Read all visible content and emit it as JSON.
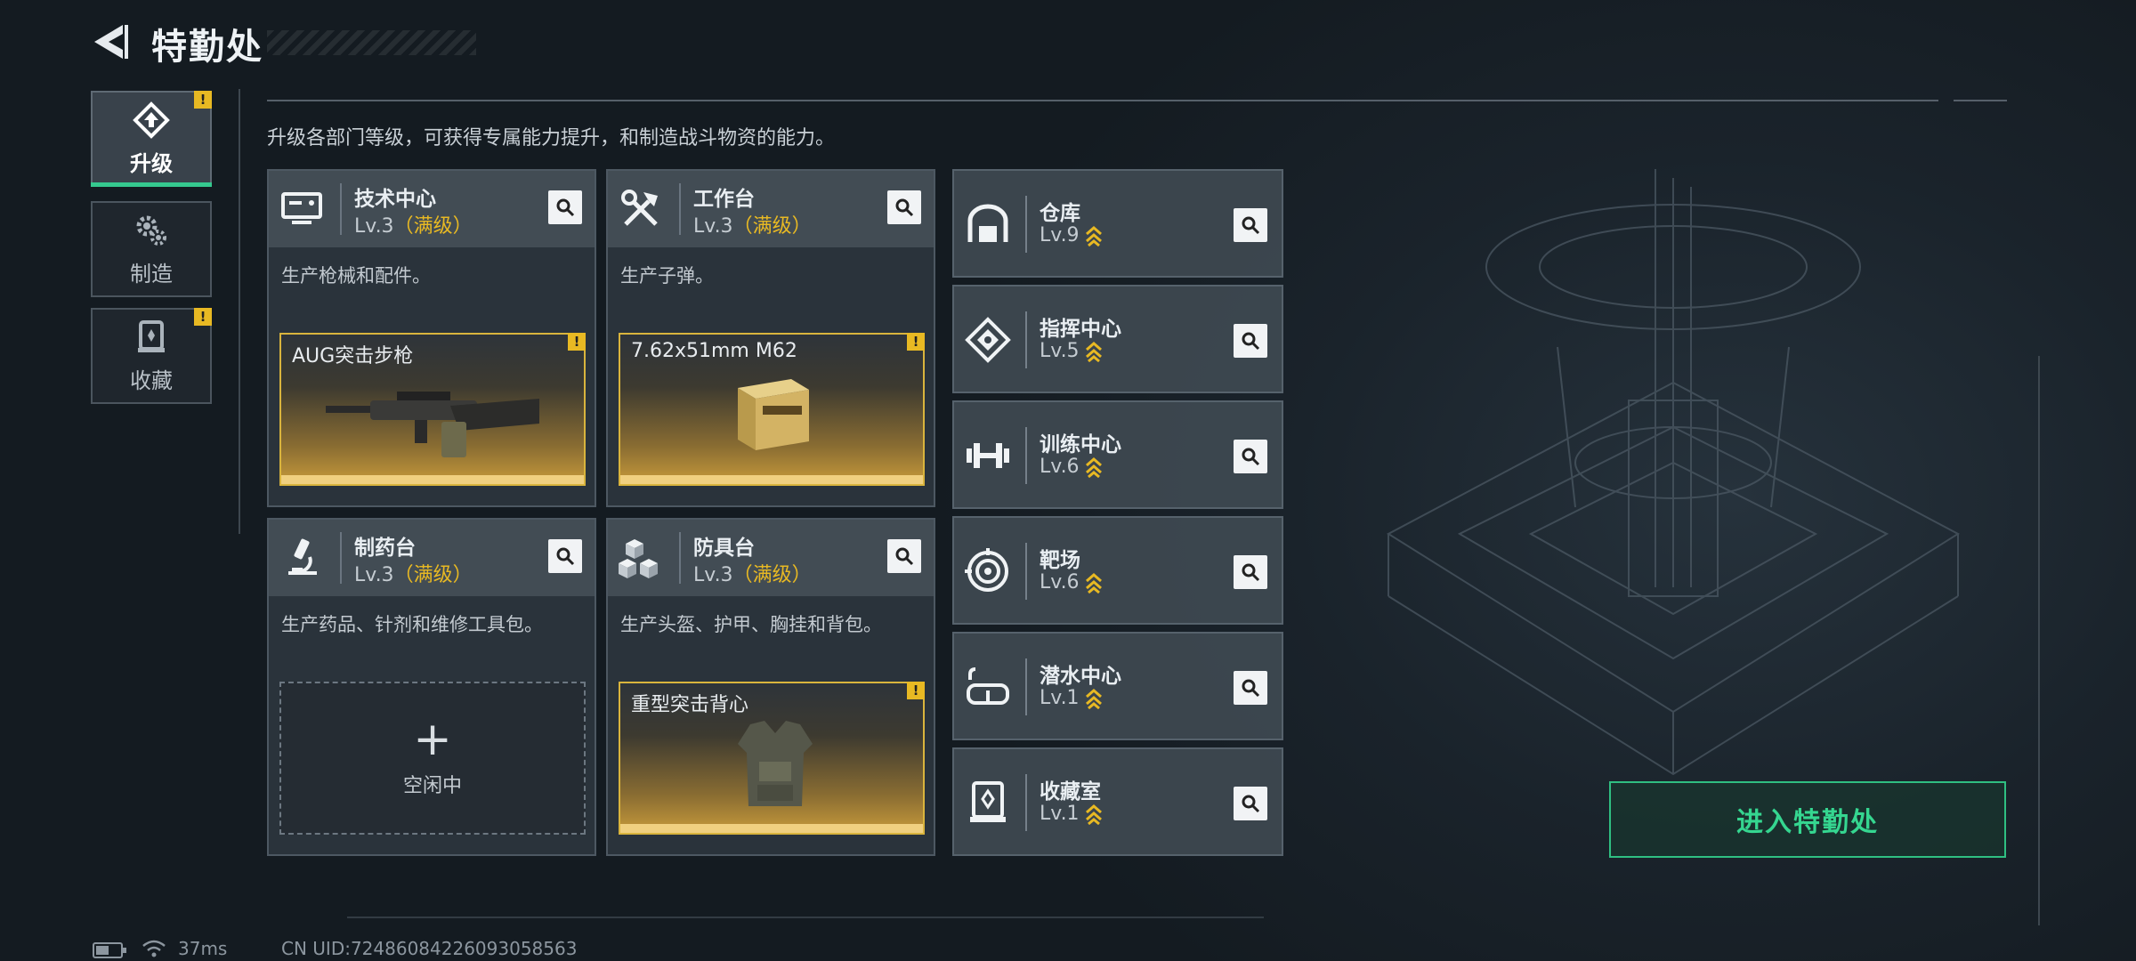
{
  "header": {
    "title": "特勤处"
  },
  "tabs": [
    {
      "label": "升级",
      "icon": "upgrade-icon",
      "active": true,
      "badge": "!"
    },
    {
      "label": "制造",
      "icon": "gears-icon",
      "active": false,
      "badge": ""
    },
    {
      "label": "收藏",
      "icon": "collection-icon",
      "active": false,
      "badge": "!"
    }
  ],
  "description": "升级各部门等级，可获得专属能力提升，和制造战斗物资的能力。",
  "cards": [
    {
      "name": "技术中心",
      "level": "Lv.3",
      "max": "（满级）",
      "icon": "computer-icon",
      "desc": "生产枪械和配件。",
      "slot": {
        "type": "item",
        "name": "AUG突击步枪",
        "badge": "!"
      }
    },
    {
      "name": "工作台",
      "level": "Lv.3",
      "max": "（满级）",
      "icon": "tools-icon",
      "desc": "生产子弹。",
      "slot": {
        "type": "item",
        "name": "7.62x51mm M62",
        "badge": "!"
      }
    },
    {
      "name": "制药台",
      "level": "Lv.3",
      "max": "（满级）",
      "icon": "microscope-icon",
      "desc": "生产药品、针剂和维修工具包。",
      "slot": {
        "type": "empty",
        "plus": "+",
        "name": "空闲中"
      }
    },
    {
      "name": "防具台",
      "level": "Lv.3",
      "max": "（满级）",
      "icon": "boxes-icon",
      "desc": "生产头盔、护甲、胸挂和背包。",
      "slot": {
        "type": "item",
        "name": "重型突击背心",
        "badge": "!"
      }
    }
  ],
  "facilities": [
    {
      "name": "仓库",
      "level": "Lv.9",
      "icon": "warehouse-icon"
    },
    {
      "name": "指挥中心",
      "level": "Lv.5",
      "icon": "command-icon"
    },
    {
      "name": "训练中心",
      "level": "Lv.6",
      "icon": "dumbbell-icon"
    },
    {
      "name": "靶场",
      "level": "Lv.6",
      "icon": "target-icon"
    },
    {
      "name": "潜水中心",
      "level": "Lv.1",
      "icon": "diving-mask-icon"
    },
    {
      "name": "收藏室",
      "level": "Lv.1",
      "icon": "collection-room-icon"
    }
  ],
  "enter_button": "进入特勤处",
  "status": {
    "ping": "37ms",
    "uid": "CN UID:72486084226093058563"
  },
  "colors": {
    "accent": "#35c98f",
    "gold": "#e8b923",
    "panel": "#303941"
  }
}
